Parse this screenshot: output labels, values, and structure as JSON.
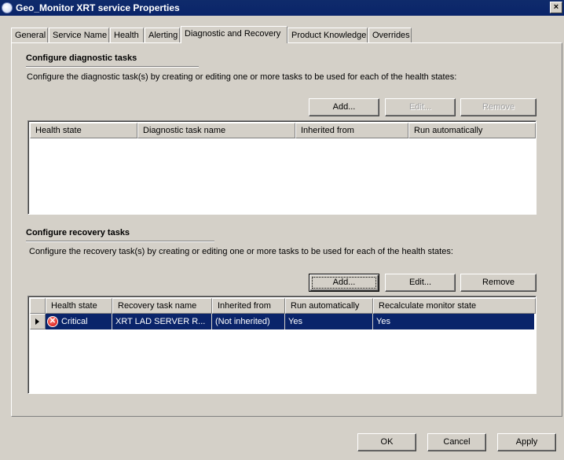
{
  "window": {
    "title": "Geo_Monitor XRT service Properties",
    "close_label": "×"
  },
  "tabs": [
    {
      "label": "General"
    },
    {
      "label": "Service Name"
    },
    {
      "label": "Health"
    },
    {
      "label": "Alerting"
    },
    {
      "label": "Diagnostic and Recovery",
      "active": true
    },
    {
      "label": "Product Knowledge"
    },
    {
      "label": "Overrides"
    }
  ],
  "diagnostic": {
    "title": "Configure diagnostic tasks",
    "description": "Configure the diagnostic task(s) by creating or editing one or more tasks to be used for each of the health states:",
    "buttons": {
      "add": "Add...",
      "edit": "Edit...",
      "remove": "Remove"
    },
    "columns": [
      "Health state",
      "Diagnostic task name",
      "Inherited from",
      "Run automatically"
    ]
  },
  "recovery": {
    "title": "Configure recovery tasks",
    "description": "Configure the recovery task(s) by creating or editing one or more tasks to be used for each of the health states:",
    "buttons": {
      "add": "Add...",
      "edit": "Edit...",
      "remove": "Remove"
    },
    "columns": [
      "Health state",
      "Recovery task name",
      "Inherited from",
      "Run automatically",
      "Recalculate monitor state"
    ],
    "rows": [
      {
        "health_state": "Critical",
        "task_name": "XRT LAD SERVER R...",
        "inherited_from": "(Not inherited)",
        "run_automatically": "Yes",
        "recalculate": "Yes",
        "icon": "critical-error-icon",
        "icon_glyph": "✕"
      }
    ]
  },
  "footer": {
    "ok": "OK",
    "cancel": "Cancel",
    "apply": "Apply"
  },
  "colors": {
    "selection": "#0a246a",
    "face": "#d4d0c8",
    "titlebar": "#0a246a",
    "critical": "#d00000"
  }
}
